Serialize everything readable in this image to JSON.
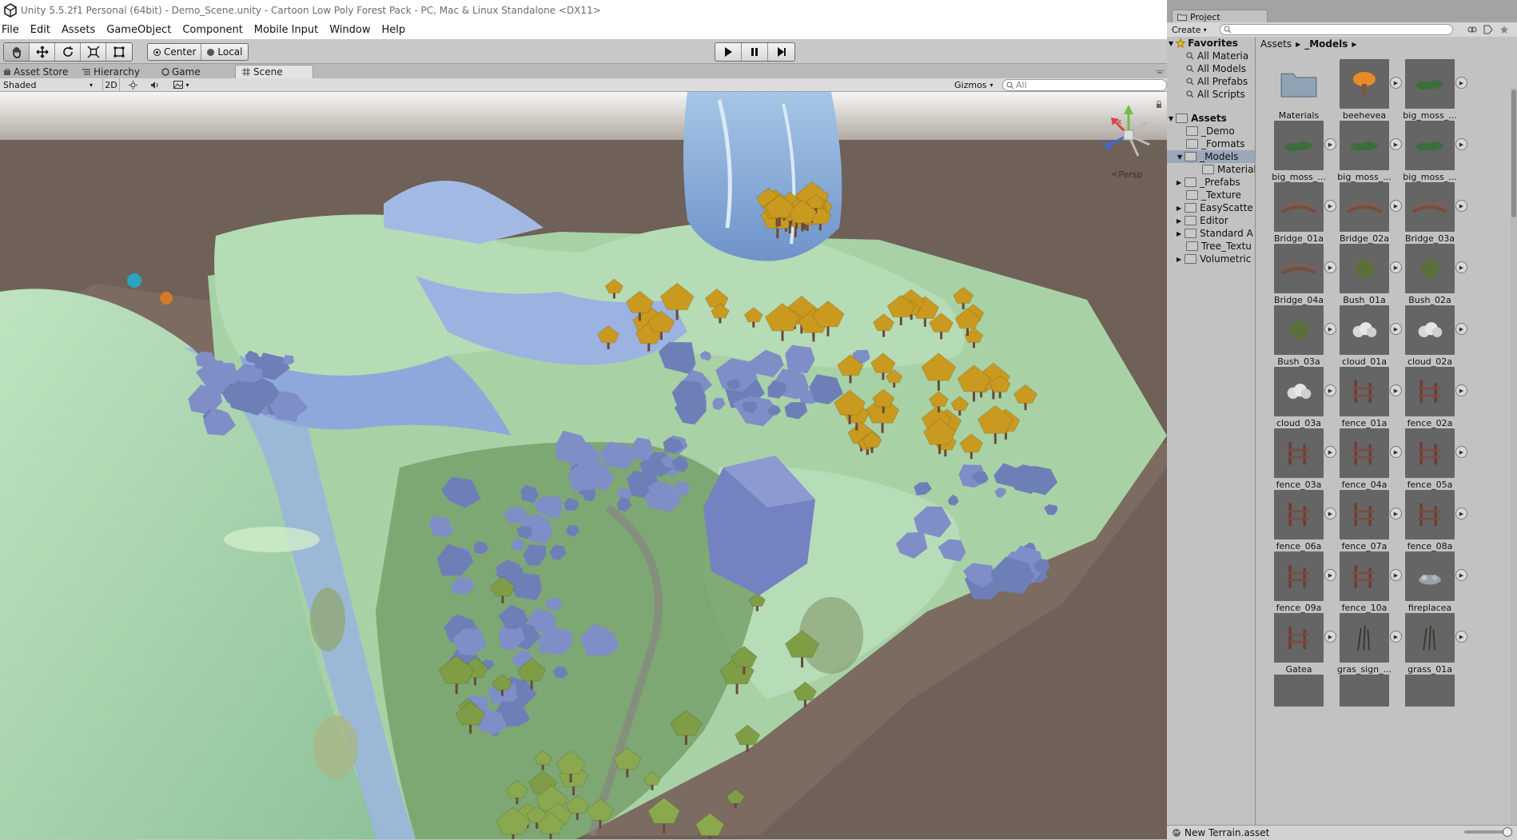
{
  "window": {
    "title": "Unity 5.5.2f1 Personal (64bit) - Demo_Scene.unity - Cartoon Low Poly Forest Pack - PC, Mac & Linux Standalone <DX11>"
  },
  "menu": [
    "File",
    "Edit",
    "Assets",
    "GameObject",
    "Component",
    "Mobile Input",
    "Window",
    "Help"
  ],
  "toolbar": {
    "tools": [
      "hand-icon",
      "move-icon",
      "rotate-icon",
      "scale-icon",
      "rect-tool-icon"
    ],
    "pivot_label": "Center",
    "space_label": "Local",
    "play": [
      "play-icon",
      "pause-icon",
      "step-icon"
    ]
  },
  "tabs": {
    "asset_store": "Asset Store",
    "hierarchy": "Hierarchy",
    "game": "Game",
    "scene": "Scene"
  },
  "scene_toolbar": {
    "shading": "Shaded",
    "mode_2d": "2D",
    "gizmos": "Gizmos",
    "search_placeholder": "All"
  },
  "viewport": {
    "projection_label": "Persp",
    "gizmo_axis_z": "z",
    "gizmo_axis_x": "x"
  },
  "project": {
    "tab": "Project",
    "create_label": "Create",
    "search_placeholder": "",
    "favorites": {
      "label": "Favorites",
      "items": [
        "All Materia",
        "All Models",
        "All Prefabs",
        "All Scripts"
      ]
    },
    "assets": {
      "label": "Assets",
      "items": [
        "_Demo",
        "_Formats",
        "_Models",
        "Materials",
        "_Prefabs",
        "_Texture",
        "EasyScatte",
        "Editor",
        "Standard A",
        "Tree_Textu",
        "Volumetric"
      ]
    },
    "breadcrumb": [
      "Assets",
      "_Models"
    ],
    "grid": [
      "Materials",
      "beehevea",
      "big_moss_...",
      "big_moss_...",
      "big_moss_...",
      "big_moss_...",
      "Bridge_01a",
      "Bridge_02a",
      "Bridge_03a",
      "Bridge_04a",
      "Bush_01a",
      "Bush_02a",
      "Bush_03a",
      "cloud_01a",
      "cloud_02a",
      "cloud_03a",
      "fence_01a",
      "fence_02a",
      "fence_03a",
      "fence_04a",
      "fence_05a",
      "fence_06a",
      "fence_07a",
      "fence_08a",
      "fence_09a",
      "fence_10a",
      "fireplacea",
      "Gatea",
      "gras_sign_...",
      "grass_01a"
    ],
    "status_file": "New Terrain.asset"
  },
  "colors": {
    "accent_selection": "#3d6fb6",
    "tree_autumn": "#c99a1f",
    "rock": "#6e7fb8",
    "grass": "#a8d2a6"
  }
}
